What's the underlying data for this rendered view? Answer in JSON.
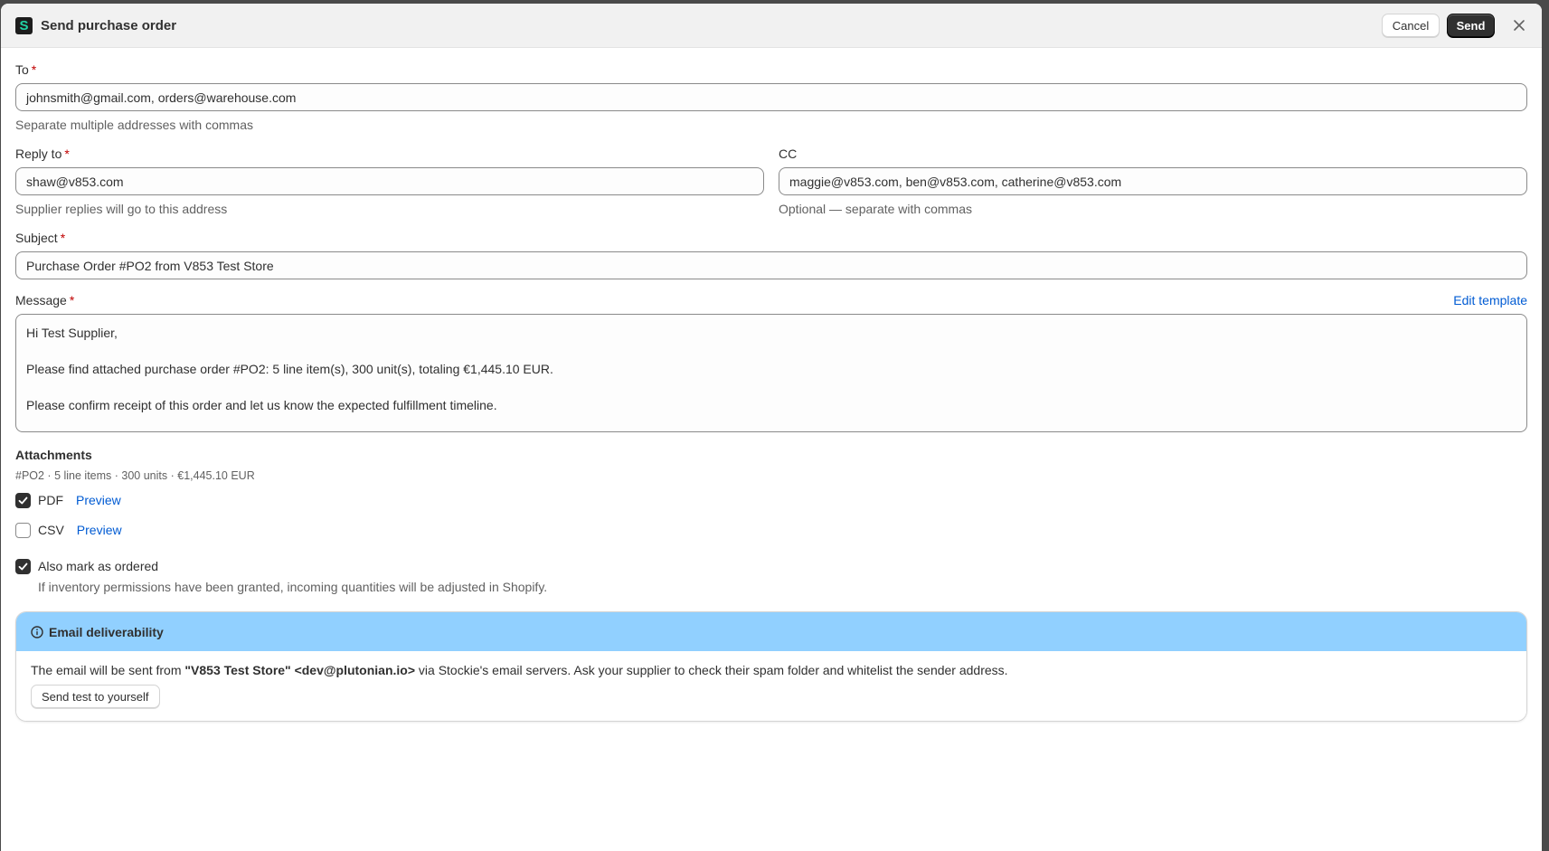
{
  "header": {
    "logo_letter": "S",
    "title": "Send purchase order",
    "cancel_label": "Cancel",
    "send_label": "Send"
  },
  "to": {
    "label": "To",
    "required_mark": "*",
    "value": "johnsmith@gmail.com, orders@warehouse.com",
    "help": "Separate multiple addresses with commas"
  },
  "reply_to": {
    "label": "Reply to",
    "required_mark": "*",
    "value": "shaw@v853.com",
    "help": "Supplier replies will go to this address"
  },
  "cc": {
    "label": "CC",
    "value": "maggie@v853.com, ben@v853.com, catherine@v853.com",
    "help": "Optional — separate with commas"
  },
  "subject": {
    "label": "Subject",
    "required_mark": "*",
    "value": "Purchase Order #PO2 from V853 Test Store"
  },
  "message": {
    "label": "Message",
    "required_mark": "*",
    "edit_template_label": "Edit template",
    "lines": [
      "Hi Test Supplier,",
      "Please find attached purchase order #PO2: 5 line item(s), 300 unit(s), totaling €1,445.10 EUR.",
      "Please confirm receipt of this order and let us know the expected fulfillment timeline."
    ]
  },
  "attachments": {
    "title": "Attachments",
    "summary": "#PO2 · 5 line items · 300 units · €1,445.10 EUR",
    "items": [
      {
        "label": "PDF",
        "checked": true,
        "preview_label": "Preview"
      },
      {
        "label": "CSV",
        "checked": false,
        "preview_label": "Preview"
      }
    ]
  },
  "mark_ordered": {
    "label": "Also mark as ordered",
    "checked": true,
    "help": "If inventory permissions have been granted, incoming quantities will be adjusted in Shopify."
  },
  "deliverability": {
    "title": "Email deliverability",
    "text_before": "The email will be sent from ",
    "sender": "\"V853 Test Store\" <dev@plutonian.io>",
    "text_after": " via Stockie's email servers. Ask your supplier to check their spam folder and whitelist the sender address.",
    "test_button_label": "Send test to yourself"
  },
  "colors": {
    "banner_bg": "#91d0ff",
    "link": "#005bd3",
    "primary_button": "#303030",
    "required": "#c00000"
  }
}
